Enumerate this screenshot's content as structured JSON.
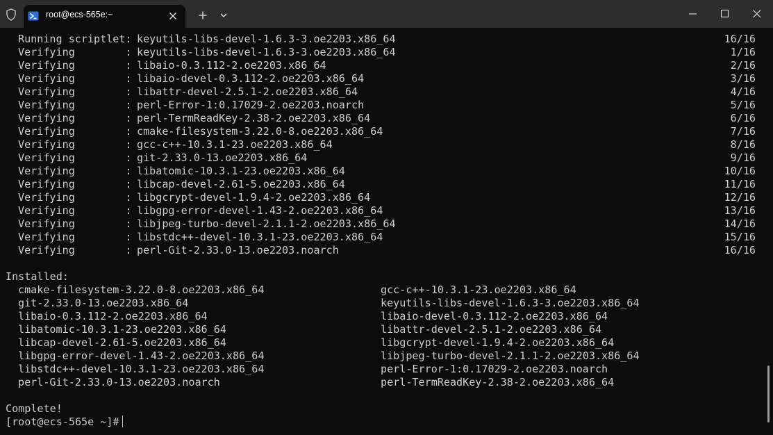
{
  "window": {
    "tab_title": "root@ecs-565e:~",
    "icons": {
      "shield": "shield-icon",
      "tab": "powershell-icon",
      "close_tab": "close-icon",
      "new_tab": "plus-icon",
      "dropdown": "chevron-down-icon",
      "minimize": "minimize-icon",
      "maximize": "maximize-icon",
      "close": "close-window-icon"
    }
  },
  "terminal": {
    "verify_lines": [
      {
        "label": "Running scriptlet:",
        "pkg": "keyutils-libs-devel-1.6.3-3.oe2203.x86_64",
        "count": "16/16"
      },
      {
        "label": "Verifying        :",
        "pkg": "keyutils-libs-devel-1.6.3-3.oe2203.x86_64",
        "count": "1/16"
      },
      {
        "label": "Verifying        :",
        "pkg": "libaio-0.3.112-2.oe2203.x86_64",
        "count": "2/16"
      },
      {
        "label": "Verifying        :",
        "pkg": "libaio-devel-0.3.112-2.oe2203.x86_64",
        "count": "3/16"
      },
      {
        "label": "Verifying        :",
        "pkg": "libattr-devel-2.5.1-2.oe2203.x86_64",
        "count": "4/16"
      },
      {
        "label": "Verifying        :",
        "pkg": "perl-Error-1:0.17029-2.oe2203.noarch",
        "count": "5/16"
      },
      {
        "label": "Verifying        :",
        "pkg": "perl-TermReadKey-2.38-2.oe2203.x86_64",
        "count": "6/16"
      },
      {
        "label": "Verifying        :",
        "pkg": "cmake-filesystem-3.22.0-8.oe2203.x86_64",
        "count": "7/16"
      },
      {
        "label": "Verifying        :",
        "pkg": "gcc-c++-10.3.1-23.oe2203.x86_64",
        "count": "8/16"
      },
      {
        "label": "Verifying        :",
        "pkg": "git-2.33.0-13.oe2203.x86_64",
        "count": "9/16"
      },
      {
        "label": "Verifying        :",
        "pkg": "libatomic-10.3.1-23.oe2203.x86_64",
        "count": "10/16"
      },
      {
        "label": "Verifying        :",
        "pkg": "libcap-devel-2.61-5.oe2203.x86_64",
        "count": "11/16"
      },
      {
        "label": "Verifying        :",
        "pkg": "libgcrypt-devel-1.9.4-2.oe2203.x86_64",
        "count": "12/16"
      },
      {
        "label": "Verifying        :",
        "pkg": "libgpg-error-devel-1.43-2.oe2203.x86_64",
        "count": "13/16"
      },
      {
        "label": "Verifying        :",
        "pkg": "libjpeg-turbo-devel-2.1.1-2.oe2203.x86_64",
        "count": "14/16"
      },
      {
        "label": "Verifying        :",
        "pkg": "libstdc++-devel-10.3.1-23.oe2203.x86_64",
        "count": "15/16"
      },
      {
        "label": "Verifying        :",
        "pkg": "perl-Git-2.33.0-13.oe2203.noarch",
        "count": "16/16"
      }
    ],
    "installed_header": "Installed:",
    "installed": [
      [
        "cmake-filesystem-3.22.0-8.oe2203.x86_64",
        "gcc-c++-10.3.1-23.oe2203.x86_64"
      ],
      [
        "git-2.33.0-13.oe2203.x86_64",
        "keyutils-libs-devel-1.6.3-3.oe2203.x86_64"
      ],
      [
        "libaio-0.3.112-2.oe2203.x86_64",
        "libaio-devel-0.3.112-2.oe2203.x86_64"
      ],
      [
        "libatomic-10.3.1-23.oe2203.x86_64",
        "libattr-devel-2.5.1-2.oe2203.x86_64"
      ],
      [
        "libcap-devel-2.61-5.oe2203.x86_64",
        "libgcrypt-devel-1.9.4-2.oe2203.x86_64"
      ],
      [
        "libgpg-error-devel-1.43-2.oe2203.x86_64",
        "libjpeg-turbo-devel-2.1.1-2.oe2203.x86_64"
      ],
      [
        "libstdc++-devel-10.3.1-23.oe2203.x86_64",
        "perl-Error-1:0.17029-2.oe2203.noarch"
      ],
      [
        "perl-Git-2.33.0-13.oe2203.noarch",
        "perl-TermReadKey-2.38-2.oe2203.x86_64"
      ]
    ],
    "complete": "Complete!",
    "prompt": "[root@ecs-565e ~]#"
  },
  "colors": {
    "terminal_bg": "#0c0c0c",
    "titlebar_bg": "#2d2d2d",
    "text": "#cccccc"
  }
}
